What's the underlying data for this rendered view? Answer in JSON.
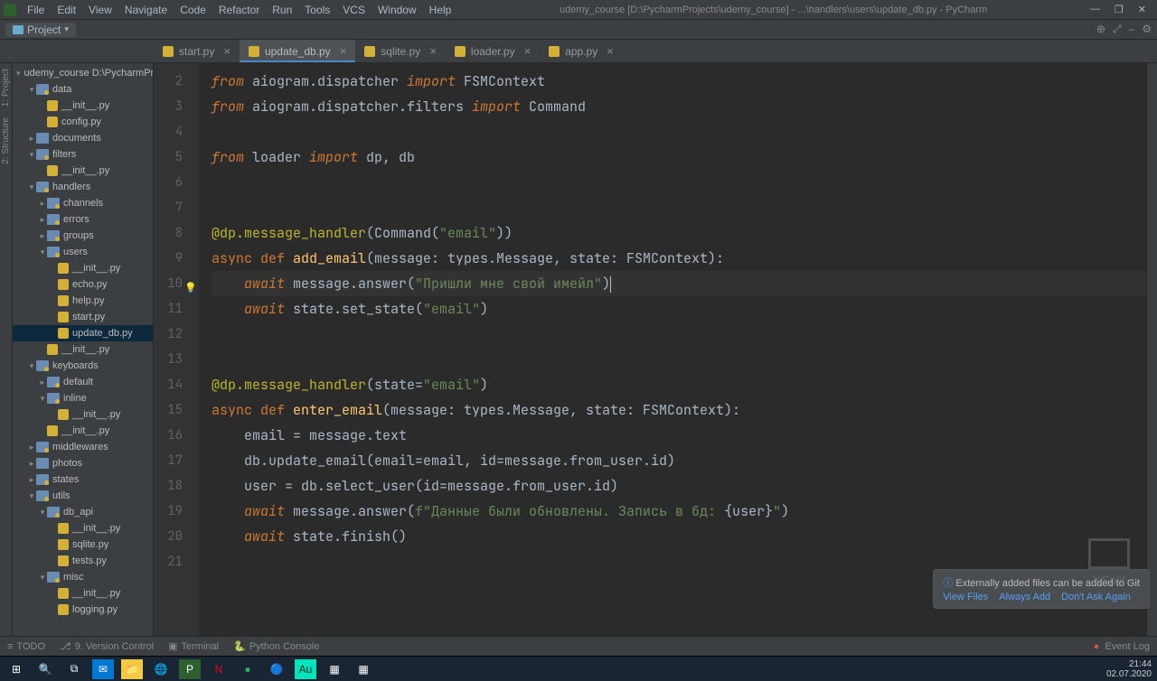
{
  "window": {
    "title": "udemy_course [D:\\PycharmProjects\\udemy_course] - ...\\handlers\\users\\update_db.py - PyCharm"
  },
  "menu": [
    "File",
    "Edit",
    "View",
    "Navigate",
    "Code",
    "Refactor",
    "Run",
    "Tools",
    "VCS",
    "Window",
    "Help"
  ],
  "toolbar": {
    "project": "Project"
  },
  "tabs": [
    {
      "name": "start.py",
      "active": false
    },
    {
      "name": "update_db.py",
      "active": true
    },
    {
      "name": "sqlite.py",
      "active": false
    },
    {
      "name": "loader.py",
      "active": false
    },
    {
      "name": "app.py",
      "active": false
    }
  ],
  "tree": [
    {
      "d": 0,
      "a": "▾",
      "ic": "folder",
      "t": "udemy_course D:\\PycharmProjec"
    },
    {
      "d": 1,
      "a": "▾",
      "ic": "pkg",
      "t": "data"
    },
    {
      "d": 2,
      "a": "",
      "ic": "py",
      "t": "__init__.py"
    },
    {
      "d": 2,
      "a": "",
      "ic": "py",
      "t": "config.py"
    },
    {
      "d": 1,
      "a": "▸",
      "ic": "folder",
      "t": "documents"
    },
    {
      "d": 1,
      "a": "▾",
      "ic": "pkg",
      "t": "filters"
    },
    {
      "d": 2,
      "a": "",
      "ic": "py",
      "t": "__init__.py"
    },
    {
      "d": 1,
      "a": "▾",
      "ic": "pkg",
      "t": "handlers"
    },
    {
      "d": 2,
      "a": "▸",
      "ic": "pkg",
      "t": "channels"
    },
    {
      "d": 2,
      "a": "▸",
      "ic": "pkg",
      "t": "errors"
    },
    {
      "d": 2,
      "a": "▸",
      "ic": "pkg",
      "t": "groups"
    },
    {
      "d": 2,
      "a": "▾",
      "ic": "pkg",
      "t": "users"
    },
    {
      "d": 3,
      "a": "",
      "ic": "py",
      "t": "__init__.py"
    },
    {
      "d": 3,
      "a": "",
      "ic": "py",
      "t": "echo.py"
    },
    {
      "d": 3,
      "a": "",
      "ic": "py",
      "t": "help.py"
    },
    {
      "d": 3,
      "a": "",
      "ic": "py",
      "t": "start.py"
    },
    {
      "d": 3,
      "a": "",
      "ic": "py",
      "t": "update_db.py",
      "sel": true
    },
    {
      "d": 2,
      "a": "",
      "ic": "py",
      "t": "__init__.py"
    },
    {
      "d": 1,
      "a": "▾",
      "ic": "pkg",
      "t": "keyboards"
    },
    {
      "d": 2,
      "a": "▸",
      "ic": "pkg",
      "t": "default"
    },
    {
      "d": 2,
      "a": "▾",
      "ic": "pkg",
      "t": "inline"
    },
    {
      "d": 3,
      "a": "",
      "ic": "py",
      "t": "__init__.py"
    },
    {
      "d": 2,
      "a": "",
      "ic": "py",
      "t": "__init__.py"
    },
    {
      "d": 1,
      "a": "▸",
      "ic": "pkg",
      "t": "middlewares"
    },
    {
      "d": 1,
      "a": "▸",
      "ic": "folder",
      "t": "photos"
    },
    {
      "d": 1,
      "a": "▸",
      "ic": "pkg",
      "t": "states"
    },
    {
      "d": 1,
      "a": "▾",
      "ic": "pkg",
      "t": "utils"
    },
    {
      "d": 2,
      "a": "▾",
      "ic": "pkg",
      "t": "db_api"
    },
    {
      "d": 3,
      "a": "",
      "ic": "py",
      "t": "__init__.py"
    },
    {
      "d": 3,
      "a": "",
      "ic": "py",
      "t": "sqlite.py"
    },
    {
      "d": 3,
      "a": "",
      "ic": "py",
      "t": "tests.py"
    },
    {
      "d": 2,
      "a": "▾",
      "ic": "pkg",
      "t": "misc"
    },
    {
      "d": 3,
      "a": "",
      "ic": "py",
      "t": "__init__.py"
    },
    {
      "d": 3,
      "a": "",
      "ic": "py",
      "t": "logging.py"
    }
  ],
  "lines": [
    2,
    3,
    4,
    5,
    6,
    7,
    8,
    9,
    10,
    11,
    12,
    13,
    14,
    15,
    16,
    17,
    18,
    19,
    20,
    21
  ],
  "bottom": {
    "todo": "TODO",
    "vcs": "9. Version Control",
    "term": "Terminal",
    "pycon": "Python Console",
    "eventlog": "Event Log"
  },
  "notif": {
    "msg": "Externally added files can be added to Git",
    "links": [
      "View Files",
      "Always Add",
      "Don't Ask Again"
    ]
  },
  "clock": {
    "time": "21:44",
    "date": "02.07.2020"
  },
  "leftbar": [
    "1: Project",
    "2: Structure"
  ]
}
